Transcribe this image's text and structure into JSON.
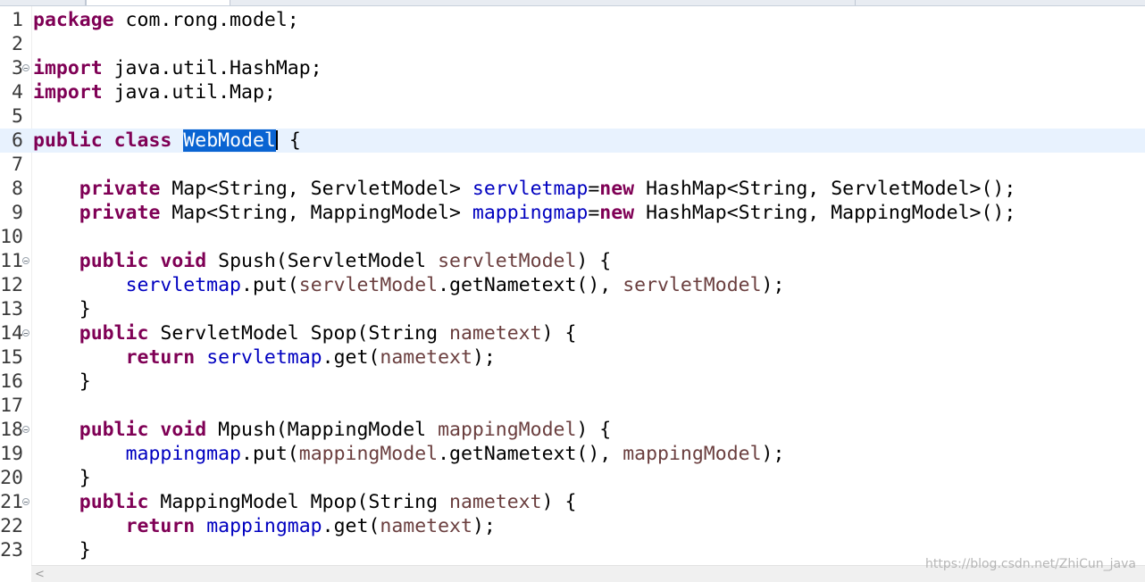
{
  "editor": {
    "current_line": 6,
    "selected_text": "WebModel",
    "lines": [
      {
        "n": "1",
        "fold": false,
        "tokens": [
          {
            "t": "kw",
            "v": "package"
          },
          {
            "t": "p",
            "v": " com.rong.model;"
          }
        ]
      },
      {
        "n": "2",
        "fold": false,
        "tokens": []
      },
      {
        "n": "3",
        "fold": true,
        "tokens": [
          {
            "t": "kw",
            "v": "import"
          },
          {
            "t": "p",
            "v": " java.util.HashMap;"
          }
        ]
      },
      {
        "n": "4",
        "fold": false,
        "tokens": [
          {
            "t": "kw",
            "v": "import"
          },
          {
            "t": "p",
            "v": " java.util.Map;"
          }
        ]
      },
      {
        "n": "5",
        "fold": false,
        "tokens": []
      },
      {
        "n": "6",
        "fold": false,
        "tokens": [
          {
            "t": "kw",
            "v": "public"
          },
          {
            "t": "p",
            "v": " "
          },
          {
            "t": "kw",
            "v": "class"
          },
          {
            "t": "p",
            "v": " "
          },
          {
            "t": "sel",
            "v": "WebModel"
          },
          {
            "t": "caret",
            "v": ""
          },
          {
            "t": "p",
            "v": " {"
          }
        ]
      },
      {
        "n": "7",
        "fold": false,
        "tokens": []
      },
      {
        "n": "8",
        "fold": false,
        "tokens": [
          {
            "t": "p",
            "v": "    "
          },
          {
            "t": "kw",
            "v": "private"
          },
          {
            "t": "p",
            "v": " Map<String, ServletModel> "
          },
          {
            "t": "fld",
            "v": "servletmap"
          },
          {
            "t": "p",
            "v": "="
          },
          {
            "t": "kw",
            "v": "new"
          },
          {
            "t": "p",
            "v": " HashMap<String, ServletModel>();"
          }
        ]
      },
      {
        "n": "9",
        "fold": false,
        "tokens": [
          {
            "t": "p",
            "v": "    "
          },
          {
            "t": "kw",
            "v": "private"
          },
          {
            "t": "p",
            "v": " Map<String, MappingModel> "
          },
          {
            "t": "fld",
            "v": "mappingmap"
          },
          {
            "t": "p",
            "v": "="
          },
          {
            "t": "kw",
            "v": "new"
          },
          {
            "t": "p",
            "v": " HashMap<String, MappingModel>();"
          }
        ]
      },
      {
        "n": "10",
        "fold": false,
        "tokens": []
      },
      {
        "n": "11",
        "fold": true,
        "tokens": [
          {
            "t": "p",
            "v": "    "
          },
          {
            "t": "kw",
            "v": "public"
          },
          {
            "t": "p",
            "v": " "
          },
          {
            "t": "kw",
            "v": "void"
          },
          {
            "t": "p",
            "v": " Spush(ServletModel "
          },
          {
            "t": "var",
            "v": "servletModel"
          },
          {
            "t": "p",
            "v": ") {"
          }
        ]
      },
      {
        "n": "12",
        "fold": false,
        "tokens": [
          {
            "t": "p",
            "v": "        "
          },
          {
            "t": "fld",
            "v": "servletmap"
          },
          {
            "t": "p",
            "v": ".put("
          },
          {
            "t": "var",
            "v": "servletModel"
          },
          {
            "t": "p",
            "v": ".getNametext(), "
          },
          {
            "t": "var",
            "v": "servletModel"
          },
          {
            "t": "p",
            "v": ");"
          }
        ]
      },
      {
        "n": "13",
        "fold": false,
        "tokens": [
          {
            "t": "p",
            "v": "    }"
          }
        ]
      },
      {
        "n": "14",
        "fold": true,
        "tokens": [
          {
            "t": "p",
            "v": "    "
          },
          {
            "t": "kw",
            "v": "public"
          },
          {
            "t": "p",
            "v": " ServletModel Spop(String "
          },
          {
            "t": "var",
            "v": "nametext"
          },
          {
            "t": "p",
            "v": ") {"
          }
        ]
      },
      {
        "n": "15",
        "fold": false,
        "tokens": [
          {
            "t": "p",
            "v": "        "
          },
          {
            "t": "kw",
            "v": "return"
          },
          {
            "t": "p",
            "v": " "
          },
          {
            "t": "fld",
            "v": "servletmap"
          },
          {
            "t": "p",
            "v": ".get("
          },
          {
            "t": "var",
            "v": "nametext"
          },
          {
            "t": "p",
            "v": ");"
          }
        ]
      },
      {
        "n": "16",
        "fold": false,
        "tokens": [
          {
            "t": "p",
            "v": "    }"
          }
        ]
      },
      {
        "n": "17",
        "fold": false,
        "tokens": []
      },
      {
        "n": "18",
        "fold": true,
        "tokens": [
          {
            "t": "p",
            "v": "    "
          },
          {
            "t": "kw",
            "v": "public"
          },
          {
            "t": "p",
            "v": " "
          },
          {
            "t": "kw",
            "v": "void"
          },
          {
            "t": "p",
            "v": " Mpush(MappingModel "
          },
          {
            "t": "var",
            "v": "mappingModel"
          },
          {
            "t": "p",
            "v": ") {"
          }
        ]
      },
      {
        "n": "19",
        "fold": false,
        "tokens": [
          {
            "t": "p",
            "v": "        "
          },
          {
            "t": "fld",
            "v": "mappingmap"
          },
          {
            "t": "p",
            "v": ".put("
          },
          {
            "t": "var",
            "v": "mappingModel"
          },
          {
            "t": "p",
            "v": ".getNametext(), "
          },
          {
            "t": "var",
            "v": "mappingModel"
          },
          {
            "t": "p",
            "v": ");"
          }
        ]
      },
      {
        "n": "20",
        "fold": false,
        "tokens": [
          {
            "t": "p",
            "v": "    }"
          }
        ]
      },
      {
        "n": "21",
        "fold": true,
        "tokens": [
          {
            "t": "p",
            "v": "    "
          },
          {
            "t": "kw",
            "v": "public"
          },
          {
            "t": "p",
            "v": " MappingModel Mpop(String "
          },
          {
            "t": "var",
            "v": "nametext"
          },
          {
            "t": "p",
            "v": ") {"
          }
        ]
      },
      {
        "n": "22",
        "fold": false,
        "tokens": [
          {
            "t": "p",
            "v": "        "
          },
          {
            "t": "kw",
            "v": "return"
          },
          {
            "t": "p",
            "v": " "
          },
          {
            "t": "fld",
            "v": "mappingmap"
          },
          {
            "t": "p",
            "v": ".get("
          },
          {
            "t": "var",
            "v": "nametext"
          },
          {
            "t": "p",
            "v": ");"
          }
        ]
      },
      {
        "n": "23",
        "fold": false,
        "tokens": [
          {
            "t": "p",
            "v": "    }"
          }
        ]
      }
    ]
  },
  "scrollbar": {
    "left_arrow": "<"
  },
  "watermark": "https://blog.csdn.net/ZhiCun_java",
  "colors": {
    "keyword": "#7f0055",
    "field": "#0000c0",
    "local_variable": "#6a3e3e",
    "selection": "#0a64d2",
    "current_line": "#e8f2fe"
  }
}
